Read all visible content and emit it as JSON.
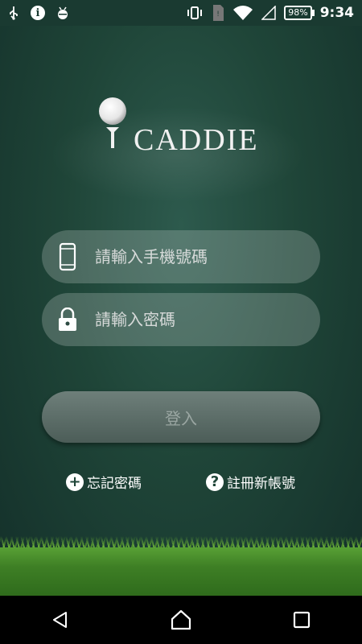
{
  "status_bar": {
    "battery_percent": "98%",
    "time": "9:34",
    "icons": [
      "usb-icon",
      "info-icon",
      "android-debug-icon",
      "vibrate-icon",
      "sim-icon",
      "wifi-icon",
      "signal-icon",
      "battery-icon"
    ]
  },
  "logo": {
    "text": "CADDIE"
  },
  "form": {
    "phone_placeholder": "請輸入手機號碼",
    "password_placeholder": "請輸入密碼",
    "login_label": "登入"
  },
  "links": {
    "forgot_password": "忘記密碼",
    "register": "註冊新帳號"
  },
  "colors": {
    "background": "#1f4538",
    "grass": "#3e7f25",
    "button": "#5e6e69"
  }
}
